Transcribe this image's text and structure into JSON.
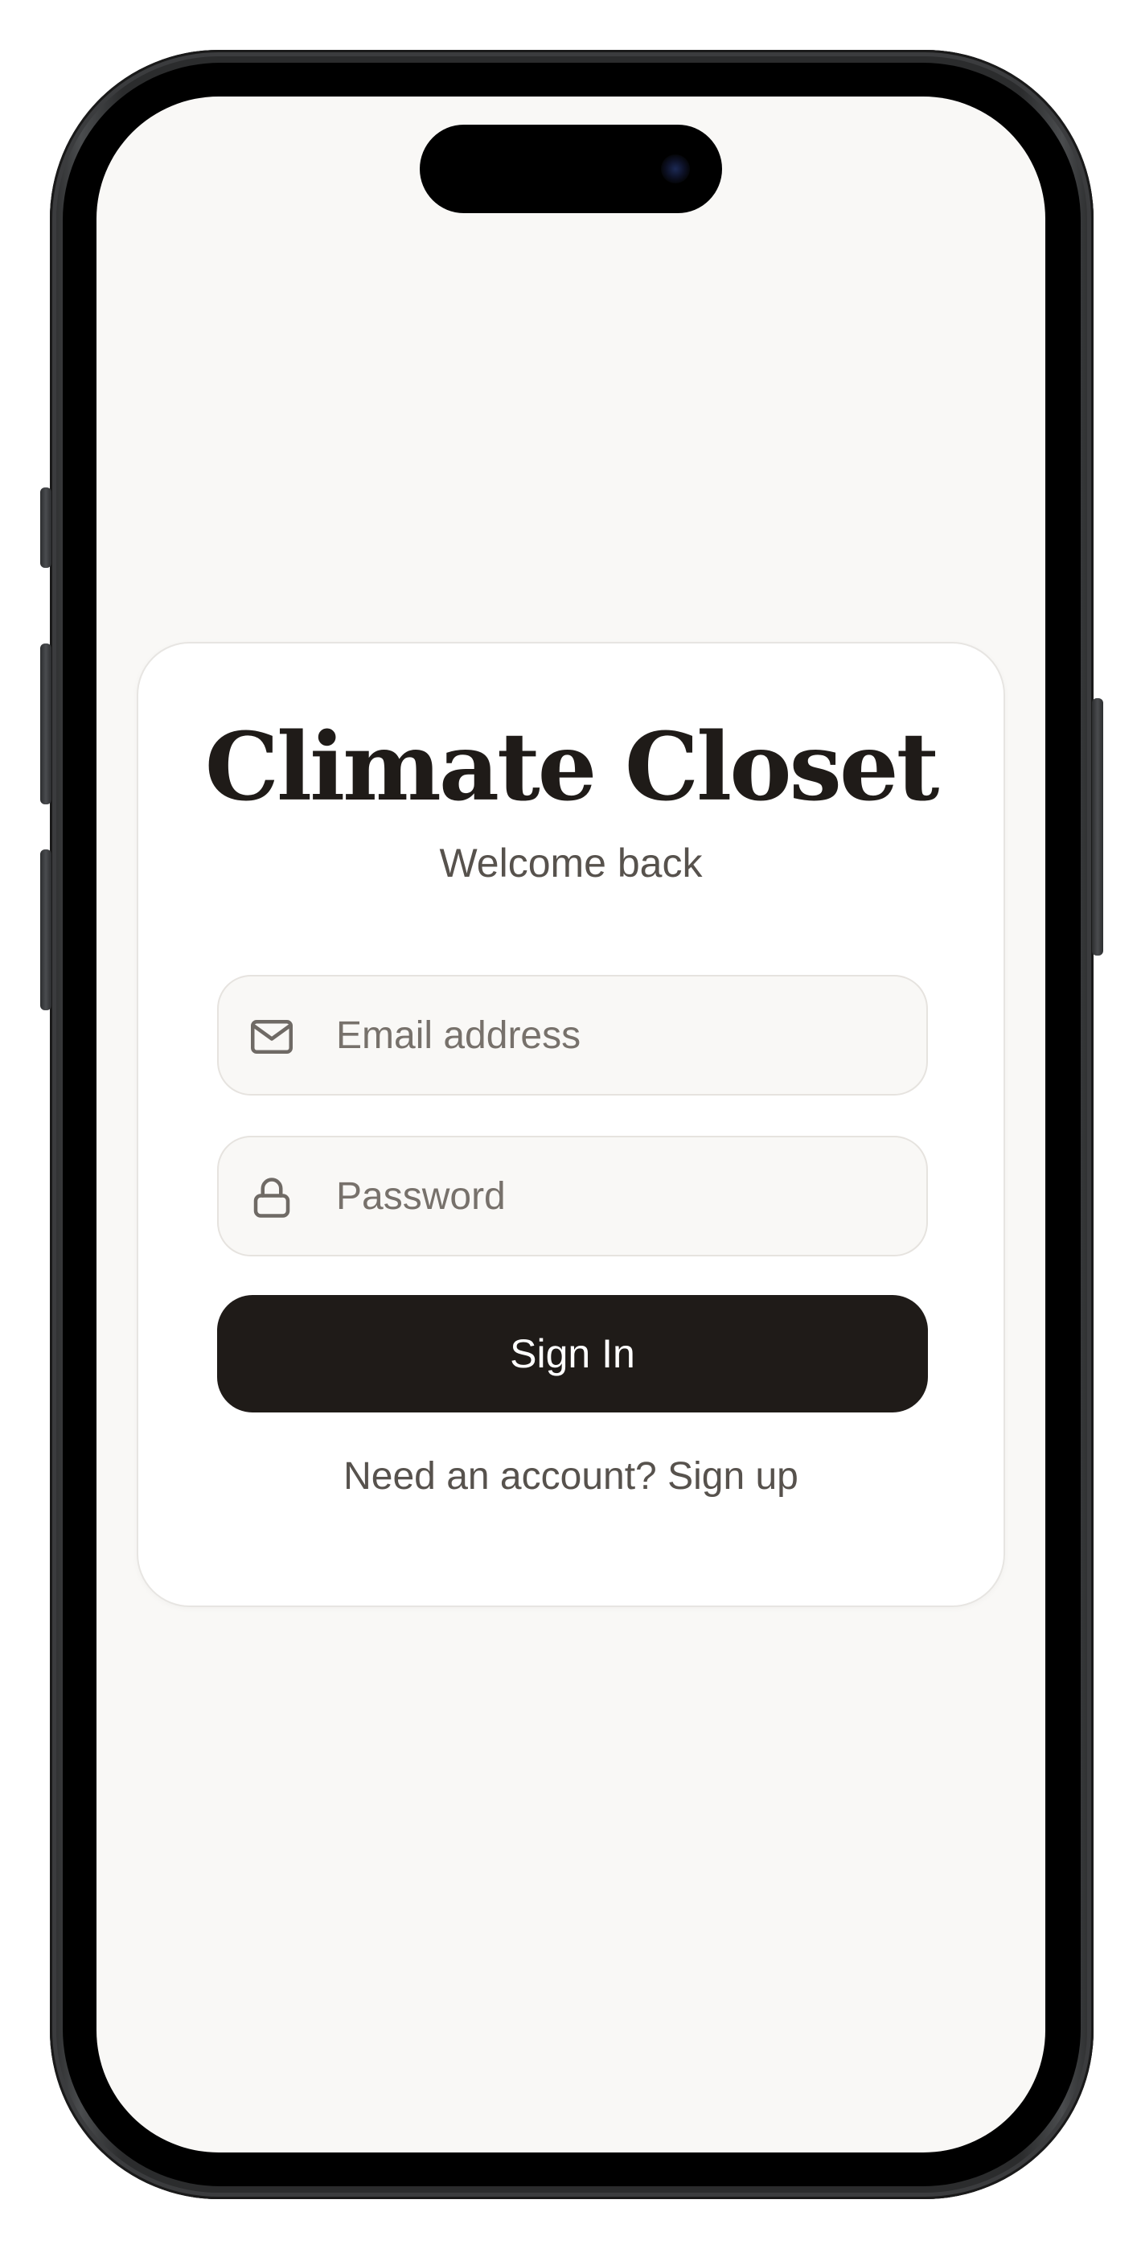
{
  "app": {
    "title": "Climate Closet",
    "subtitle": "Welcome back"
  },
  "form": {
    "email": {
      "placeholder": "Email address",
      "value": "",
      "icon": "mail-icon"
    },
    "password": {
      "placeholder": "Password",
      "value": "",
      "icon": "lock-icon"
    },
    "submit_label": "Sign In"
  },
  "footer": {
    "prompt": "Need an account?",
    "link_label": "Sign up"
  },
  "colors": {
    "background": "#f9f8f6",
    "card": "#ffffff",
    "primary": "#1f1b18",
    "muted_text": "#57524d",
    "placeholder": "#77716b",
    "border": "#e6e3df"
  }
}
